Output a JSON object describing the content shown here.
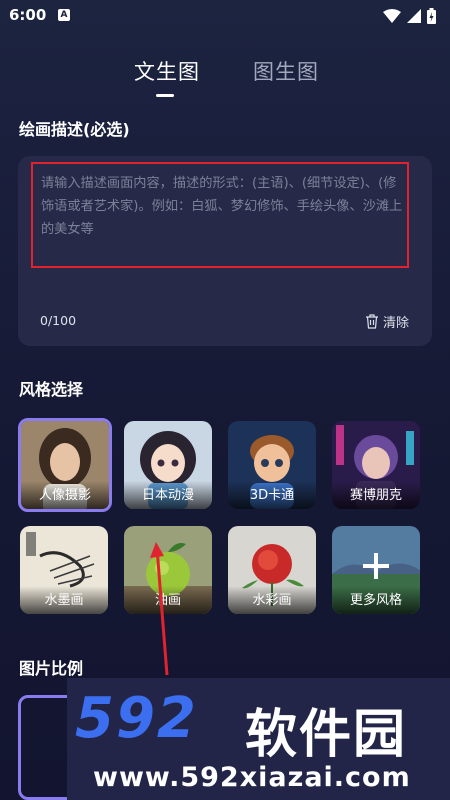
{
  "status_bar": {
    "time": "6:00",
    "notification_letter": "A"
  },
  "tabs": [
    {
      "label": "文生图"
    },
    {
      "label": "图生图"
    }
  ],
  "prompt_section": {
    "title": "绘画描述(必选)",
    "placeholder": "请输入描述画面内容，描述的形式：(主语)、(细节设定)、(修饰语或者艺术家)。例如：白狐、梦幻修饰、手绘头像、沙滩上的美女等",
    "char_count": "0/100",
    "clear_label": "清除"
  },
  "style_section": {
    "title": "风格选择",
    "styles": [
      {
        "label": "人像摄影"
      },
      {
        "label": "日本动漫"
      },
      {
        "label": "3D卡通"
      },
      {
        "label": "赛博朋克"
      },
      {
        "label": "水墨画"
      },
      {
        "label": "油画"
      },
      {
        "label": "水彩画"
      },
      {
        "label": "更多风格"
      }
    ]
  },
  "ratio_section": {
    "title": "图片比例"
  },
  "watermark": {
    "brand": "592",
    "brand_cn": "软件园",
    "url": "www.592xiazai.com"
  },
  "colors": {
    "accent": "#8a7cf0",
    "highlight_border": "#e0232f",
    "background": "#1a1f3c",
    "card": "#262a48"
  }
}
